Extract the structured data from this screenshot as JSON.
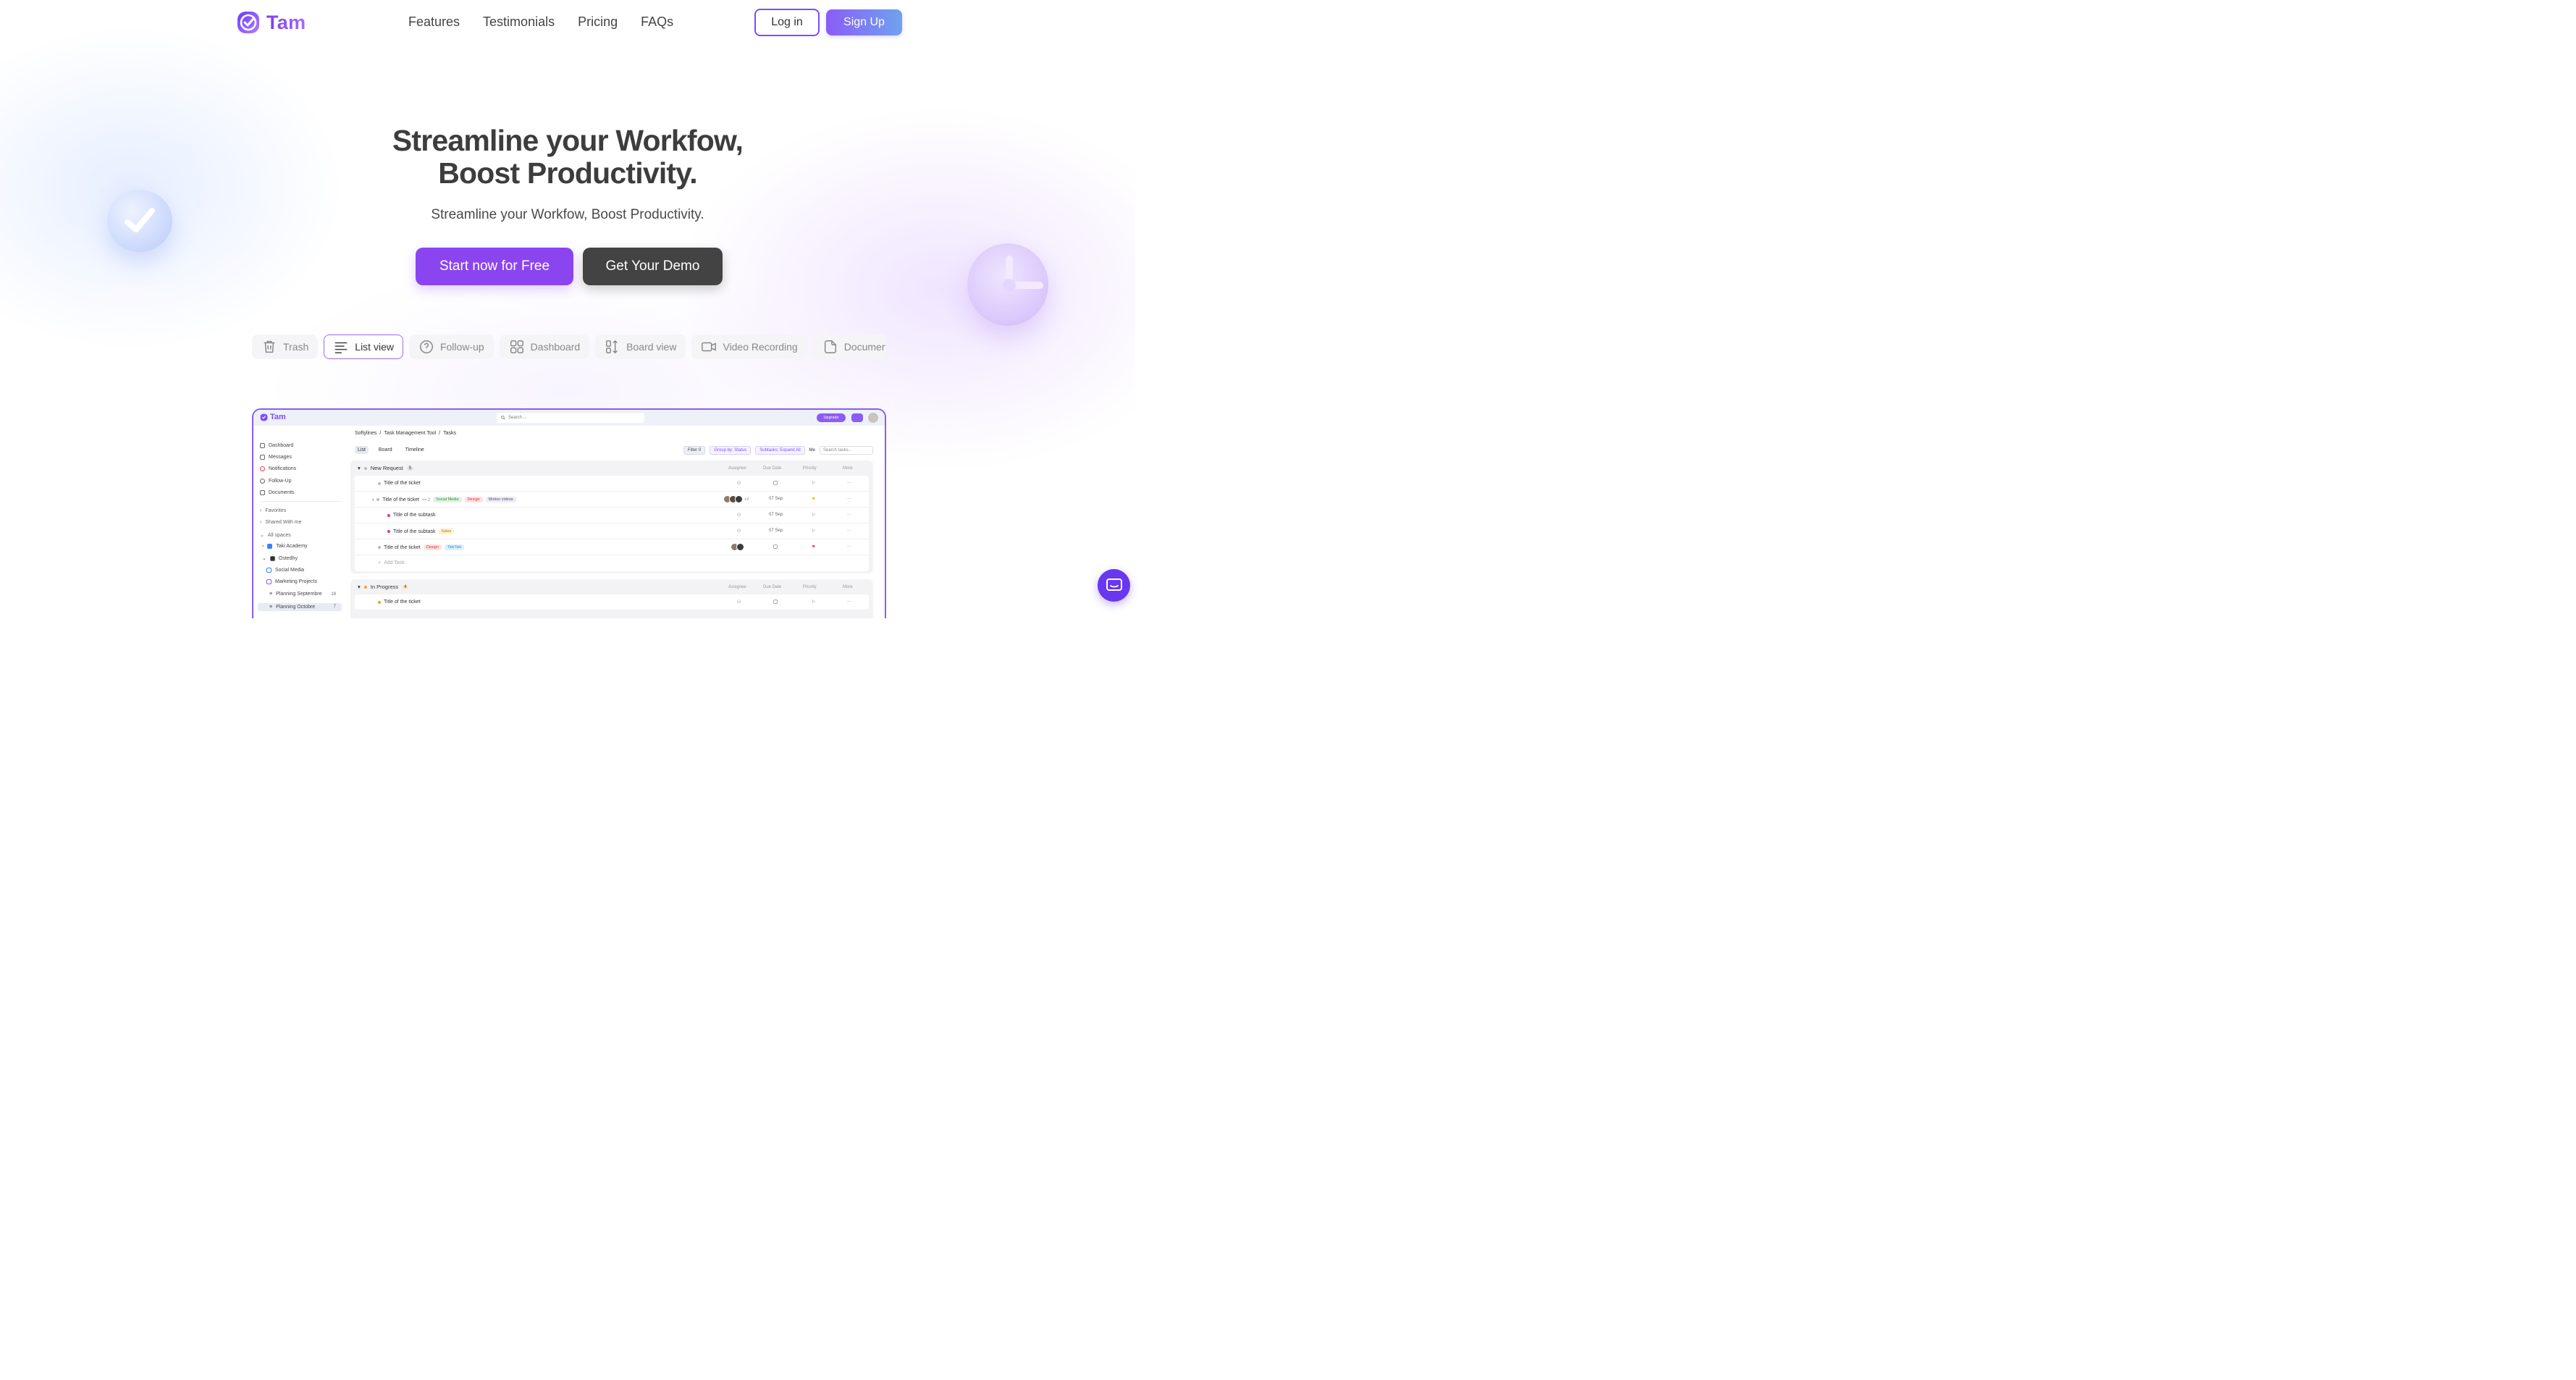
{
  "brand": {
    "name": "Tam",
    "accent": "#8b45f0"
  },
  "nav": {
    "links": [
      "Features",
      "Testimonials",
      "Pricing",
      "FAQs"
    ],
    "login_label": "Log in",
    "signup_label": "Sign Up"
  },
  "hero": {
    "title_line1": "Streamline your Workfow,",
    "title_line2": "Boost Productivity.",
    "subtitle": "Streamline your Workfow, Boost Productivity.",
    "cta_primary": "Start now for Free",
    "cta_secondary": "Get Your Demo"
  },
  "feature_tabs": [
    {
      "label": "Trash",
      "icon": "trash-icon",
      "active": false
    },
    {
      "label": "List view",
      "icon": "list-icon",
      "active": true
    },
    {
      "label": "Follow-up",
      "icon": "question-icon",
      "active": false
    },
    {
      "label": "Dashboard",
      "icon": "grid-icon",
      "active": false
    },
    {
      "label": "Board view",
      "icon": "board-icon",
      "active": false
    },
    {
      "label": "Video Recording",
      "icon": "video-icon",
      "active": false
    },
    {
      "label": "Document",
      "icon": "document-icon",
      "active": false
    },
    {
      "label": "",
      "icon": "users-icon",
      "active": false
    }
  ],
  "app_preview": {
    "logo": "Tam",
    "search_placeholder": "Search ...",
    "upgrade_label": "Upgrade",
    "sidebar": {
      "main": [
        "Dashboard",
        "Messages",
        "Notifications",
        "Follow-Up",
        "Documents"
      ],
      "sections": [
        "Favorites",
        "Shared With me",
        "All spaces"
      ],
      "spaces": [
        "Taki Academy",
        "Ostedhy"
      ],
      "folders": [
        "Social Media",
        "Marketing Projects"
      ],
      "lists": [
        {
          "name": "Planning Septembre",
          "count": "19"
        },
        {
          "name": "Planning Octobre",
          "count": "7"
        }
      ]
    },
    "breadcrumb": [
      "Softylines",
      "Task Management Tool",
      "Tasks"
    ],
    "views": [
      "List",
      "Board",
      "Timeline"
    ],
    "toolbar": {
      "filter": "Filter",
      "filter_count": "0",
      "group_by": "Group by: Status",
      "subtasks": "Subtasks: Expand All",
      "me": "Me",
      "search_tasks": "Search tasks..."
    },
    "columns": [
      "Assignee",
      "Due Date",
      "Priority",
      "More"
    ],
    "groups": [
      {
        "name": "New Request",
        "count": "5",
        "rows": [
          {
            "title": "Title of the ticket",
            "due": ""
          },
          {
            "title": "Title of the ticket",
            "subtasks": "2",
            "tags": [
              "Social Media",
              "Design",
              "Motion videos"
            ],
            "more_avatars": "+2",
            "due": "07 Sep"
          },
          {
            "title": "Title of the subtask",
            "due": "07 Sep"
          },
          {
            "title": "Title of the subtask",
            "tags": [
              "Sales"
            ],
            "due": "07 Sep"
          },
          {
            "title": "Title of the ticket",
            "tags": [
              "Design",
              "TakiTaki"
            ],
            "due": ""
          }
        ],
        "add_task": "Add Task"
      },
      {
        "name": "In Progress",
        "count": "4",
        "rows": [
          {
            "title": "Title of the ticket",
            "due": ""
          }
        ]
      }
    ]
  }
}
